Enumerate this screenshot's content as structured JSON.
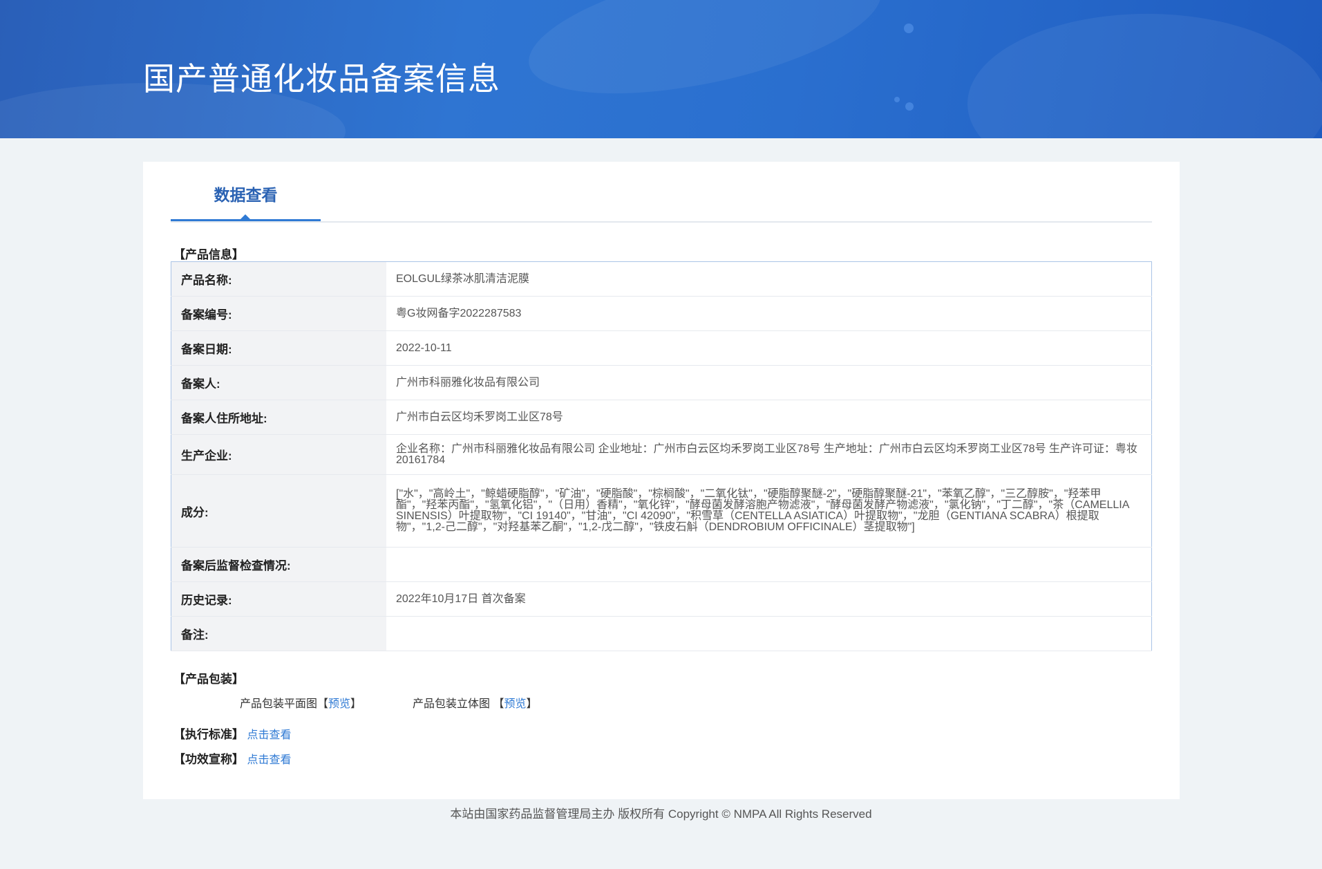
{
  "header": {
    "title": "国产普通化妆品备案信息"
  },
  "tabs": [
    {
      "label": "数据查看"
    }
  ],
  "product_info": {
    "section_title": "【产品信息】",
    "rows": [
      {
        "label": "产品名称:",
        "value": "EOLGUL绿茶冰肌清洁泥膜"
      },
      {
        "label": "备案编号:",
        "value": "粤G妆网备字2022287583"
      },
      {
        "label": "备案日期:",
        "value": "2022-10-11"
      },
      {
        "label": "备案人:",
        "value": "广州市科丽雅化妆品有限公司"
      },
      {
        "label": "备案人住所地址:",
        "value": "广州市白云区均禾罗岗工业区78号"
      },
      {
        "label": "生产企业:",
        "value": "企业名称：广州市科丽雅化妆品有限公司 企业地址：广州市白云区均禾罗岗工业区78号 生产地址：广州市白云区均禾罗岗工业区78号 生产许可证：粤妆20161784"
      },
      {
        "label": "成分:",
        "value": "[\"水\"，\"高岭土\"，\"鲸蜡硬脂醇\"，\"矿油\"，\"硬脂酸\"，\"棕榈酸\"，\"二氧化钛\"，\"硬脂醇聚醚-2\"，\"硬脂醇聚醚-21\"，\"苯氧乙醇\"，\"三乙醇胺\"，\"羟苯甲酯\"，\"羟苯丙酯\"，\"氢氧化铝\"，\"（日用）香精\"，\"氧化锌\"，\"酵母菌发酵溶胞产物滤液\"，\"酵母菌发酵产物滤液\"，\"氯化钠\"，\"丁二醇\"，\"茶（CAMELLIA SINENSIS）叶提取物\"，\"CI 19140\"，\"甘油\"，\"CI 42090\"，\"积雪草（CENTELLA ASIATICA）叶提取物\"，\"龙胆（GENTIANA SCABRA）根提取物\"，\"1,2-己二醇\"，\"对羟基苯乙酮\"，\"1,2-戊二醇\"，\"铁皮石斛（DENDROBIUM OFFICINALE）茎提取物\"]"
      },
      {
        "label": "备案后监督检查情况:",
        "value": ""
      },
      {
        "label": "历史记录:",
        "value": "2022年10月17日 首次备案"
      },
      {
        "label": "备注:",
        "value": ""
      }
    ]
  },
  "packaging": {
    "section_title": "【产品包装】",
    "flat_label": "产品包装平面图",
    "solid_label": "产品包装立体图",
    "bracket_open": "【",
    "bracket_close": "】",
    "preview_link": "预览"
  },
  "standard": {
    "label": "【执行标准】",
    "link": "点击查看"
  },
  "efficacy": {
    "label": "【功效宣称】",
    "link": "点击查看"
  },
  "footer": {
    "text": "本站由国家药品监督管理局主办 版权所有 Copyright © NMPA All Rights Reserved"
  }
}
